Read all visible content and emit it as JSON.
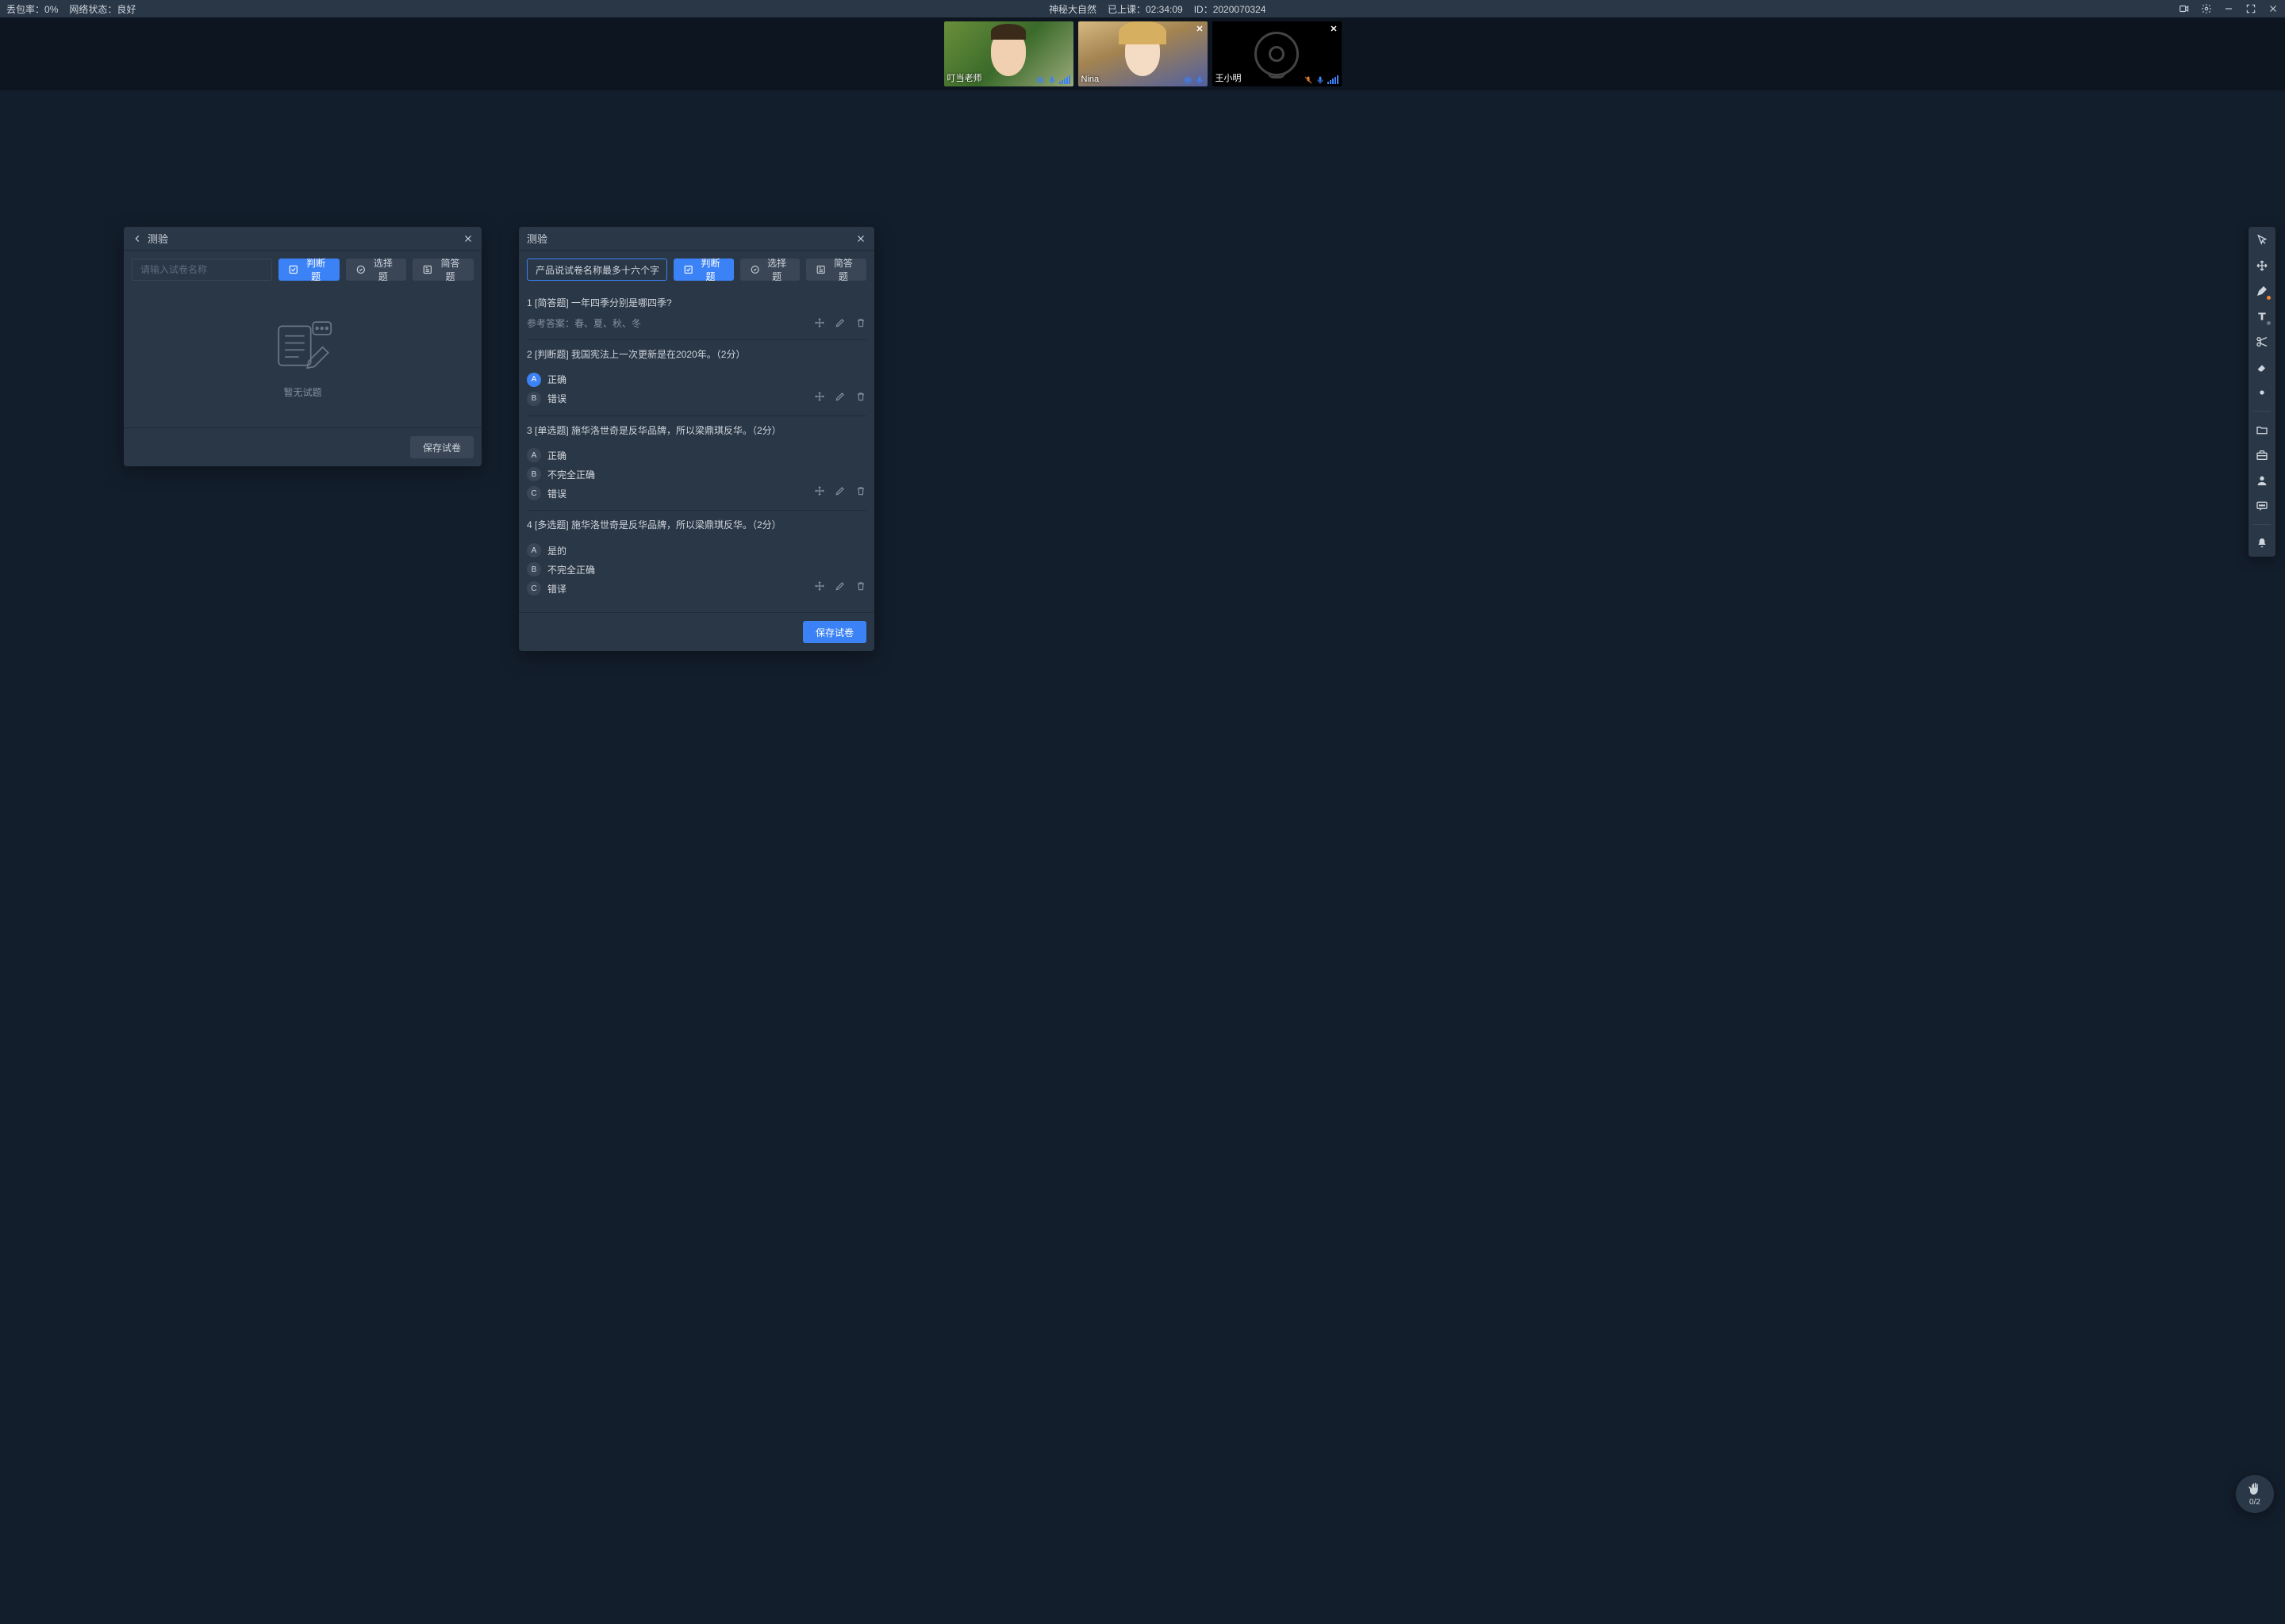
{
  "topbar": {
    "packet_loss_label": "丢包率：",
    "packet_loss_value": "0%",
    "network_label": "网络状态：",
    "network_value": "良好",
    "class_title": "神秘大自然",
    "elapsed_label": "已上课：",
    "elapsed_value": "02:34:09",
    "id_label": "ID：",
    "id_value": "2020070324"
  },
  "videos": [
    {
      "name": "叮当老师",
      "role": "teacher",
      "camera_on": true
    },
    {
      "name": "Nina",
      "role": "student",
      "camera_on": true
    },
    {
      "name": "王小明",
      "role": "student",
      "camera_on": false
    }
  ],
  "quiz_panel_left": {
    "title": "测验",
    "input_placeholder": "请输入试卷名称",
    "type_judge": "判断题",
    "type_choice": "选择题",
    "type_short": "简答题",
    "empty_text": "暂无试题",
    "save_label": "保存试卷"
  },
  "quiz_panel_right": {
    "title": "测验",
    "input_value": "产品说试卷名称最多十六个字",
    "type_judge": "判断题",
    "type_choice": "选择题",
    "type_short": "简答题",
    "save_label": "保存试卷",
    "answer_prefix": "参考答案：",
    "questions": [
      {
        "num": "1",
        "tag": "[简答题]",
        "text": "一年四季分别是哪四季?",
        "answer": "春、夏、秋、冬",
        "options": []
      },
      {
        "num": "2",
        "tag": "[判断题]",
        "text": "我国宪法上一次更新是在2020年。（2分）",
        "options": [
          {
            "k": "A",
            "v": "正确",
            "sel": true
          },
          {
            "k": "B",
            "v": "错误",
            "sel": false
          }
        ]
      },
      {
        "num": "3",
        "tag": "[单选题]",
        "text": "施华洛世奇是反华品牌，所以梁鼎琪反华。（2分）",
        "options": [
          {
            "k": "A",
            "v": "正确",
            "sel": false
          },
          {
            "k": "B",
            "v": "不完全正确",
            "sel": false
          },
          {
            "k": "C",
            "v": "错误",
            "sel": false
          }
        ]
      },
      {
        "num": "4",
        "tag": "[多选题]",
        "text": "施华洛世奇是反华品牌，所以梁鼎琪反华。（2分）",
        "options": [
          {
            "k": "A",
            "v": "是的",
            "sel": false
          },
          {
            "k": "B",
            "v": "不完全正确",
            "sel": false
          },
          {
            "k": "C",
            "v": "错译",
            "sel": false
          }
        ]
      }
    ]
  },
  "hand_raise": {
    "count": "0/2"
  }
}
